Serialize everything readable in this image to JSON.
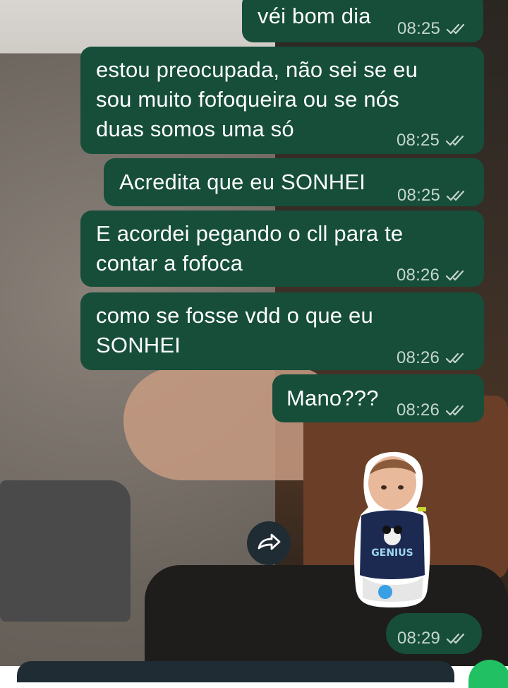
{
  "messages": [
    {
      "text": "véi bom dia",
      "time": "08:25"
    },
    {
      "text": "estou preocupada, não sei se eu\nsou muito fofoqueira ou se nós\nduas somos uma só",
      "time": "08:25"
    },
    {
      "text": "Acredita que eu SONHEI",
      "time": "08:25"
    },
    {
      "text": "E acordei pegando o cll para te\ncontar a fofoca",
      "time": "08:26"
    },
    {
      "text": "como se fosse vdd o que eu\nSONHEI",
      "time": "08:26"
    },
    {
      "text": "Mano???",
      "time": "08:26"
    }
  ],
  "sticker_message": {
    "time": "08:29",
    "sticker_text": "GENIUS"
  },
  "colors": {
    "bubble_outgoing": "#164e3a",
    "timestamp": "#c5d6cf",
    "read_ticks": "#c5d6cf",
    "forward_button": "#1f2c34",
    "mic_button": "#21c063"
  },
  "icons": {
    "read_status": "double-check-icon",
    "forward": "forward-arrow-icon"
  }
}
